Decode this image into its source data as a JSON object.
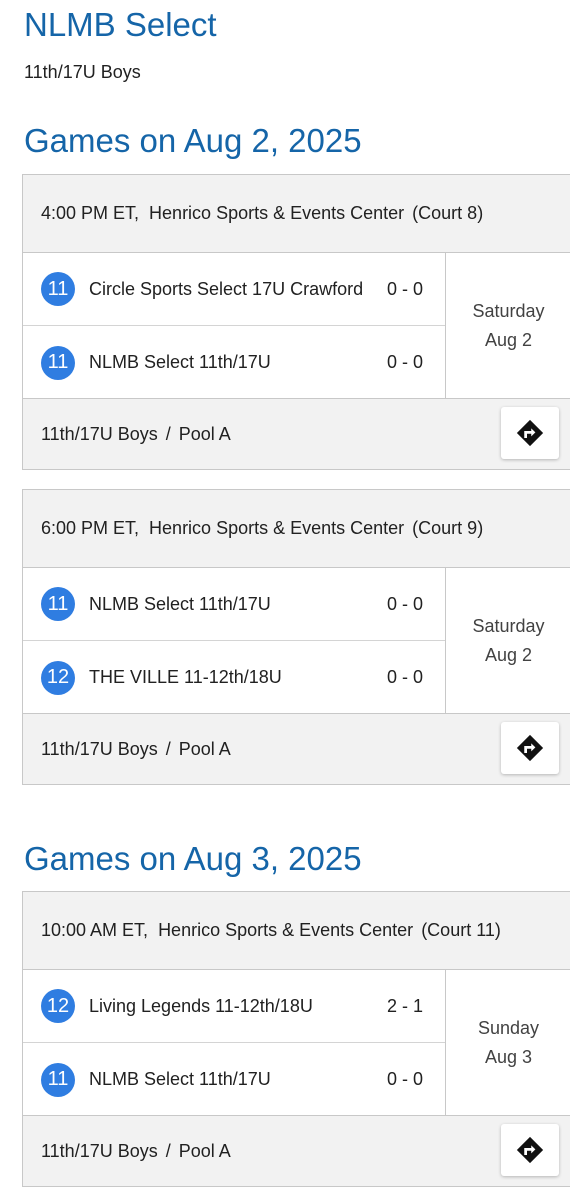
{
  "team": {
    "name": "NLMB Select",
    "division": "11th/17U Boys"
  },
  "days": [
    {
      "heading": "Games on Aug 2, 2025",
      "games": [
        {
          "time": "4:00 PM ET,",
          "venue": "Henrico Sports & Events Center",
          "court": "(Court 8)",
          "teams": [
            {
              "grade": "11",
              "name": "Circle Sports Select 17U Crawford",
              "score": "0 - 0"
            },
            {
              "grade": "11",
              "name": "NLMB Select 11th/17U",
              "score": "0 - 0"
            }
          ],
          "weekday": "Saturday",
          "date": "Aug 2",
          "division": "11th/17U Boys",
          "separator": "/",
          "pool": "Pool A",
          "directions_icon": "directions-icon"
        },
        {
          "time": "6:00 PM ET,",
          "venue": "Henrico Sports & Events Center",
          "court": "(Court 9)",
          "teams": [
            {
              "grade": "11",
              "name": "NLMB Select 11th/17U",
              "score": "0 - 0"
            },
            {
              "grade": "12",
              "name": "THE VILLE 11-12th/18U",
              "score": "0 - 0"
            }
          ],
          "weekday": "Saturday",
          "date": "Aug 2",
          "division": "11th/17U Boys",
          "separator": "/",
          "pool": "Pool A",
          "directions_icon": "directions-icon"
        }
      ]
    },
    {
      "heading": "Games on Aug 3, 2025",
      "games": [
        {
          "time": "10:00 AM ET,",
          "venue": "Henrico Sports & Events Center",
          "court": "(Court 11)",
          "teams": [
            {
              "grade": "12",
              "name": "Living Legends 11-12th/18U",
              "score": "2 - 1"
            },
            {
              "grade": "11",
              "name": "NLMB Select 11th/17U",
              "score": "0 - 0"
            }
          ],
          "weekday": "Sunday",
          "date": "Aug 3",
          "division": "11th/17U Boys",
          "separator": "/",
          "pool": "Pool A",
          "directions_icon": "directions-icon"
        }
      ]
    }
  ],
  "colors": {
    "heading": "#1565a8",
    "grade_badge": "#2f7de1",
    "panel": "#f2f2f2"
  }
}
